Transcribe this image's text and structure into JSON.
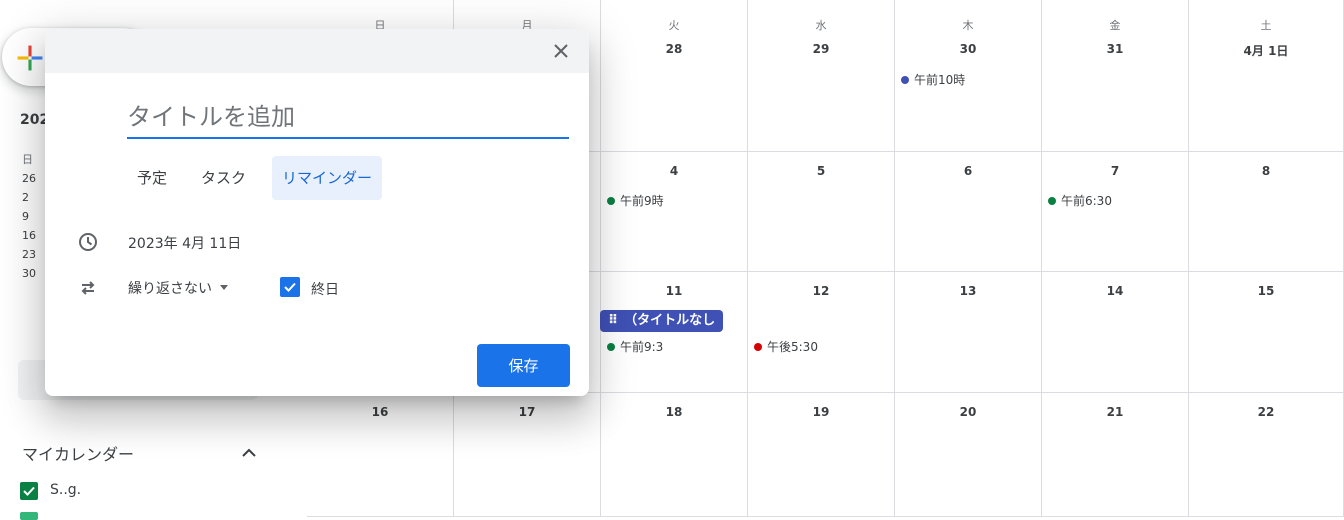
{
  "sidebar": {
    "year_partial": "202",
    "mini_days": [
      "日",
      "26",
      "2",
      "9",
      "16",
      "23",
      "30"
    ],
    "my_calendars_label": "マイカレンダー",
    "calendar_name": "S..g."
  },
  "grid": {
    "weekdays": [
      "日",
      "月",
      "火",
      "水",
      "木",
      "金",
      "土"
    ],
    "weeks": [
      [
        "",
        "",
        "28",
        "29",
        "30",
        "31",
        "4月 1日"
      ],
      [
        "",
        "",
        "4",
        "5",
        "6",
        "7",
        "8"
      ],
      [
        "",
        "",
        "11",
        "12",
        "13",
        "14",
        "15"
      ],
      [
        "16",
        "17",
        "18",
        "19",
        "20",
        "21",
        "22"
      ]
    ],
    "events": {
      "thu_w1": "午前10時",
      "tue_w2": "午前9時",
      "fri_w2": "午前6:30",
      "tue_w3": "午前9:3",
      "wed_w3": "午後5:30"
    },
    "chip_text": "（タイトルなし"
  },
  "dialog": {
    "title_placeholder": "タイトルを追加",
    "tabs": [
      "予定",
      "タスク",
      "リマインダー"
    ],
    "date_text": "2023年 4月 11日",
    "repeat_text": "繰り返さない",
    "allday_label": "終日",
    "save_label": "保存"
  },
  "colors": {
    "accent": "#1a73e8",
    "blueberry": "#3f51b5",
    "basil": "#0b8043",
    "tomato": "#d50000"
  }
}
